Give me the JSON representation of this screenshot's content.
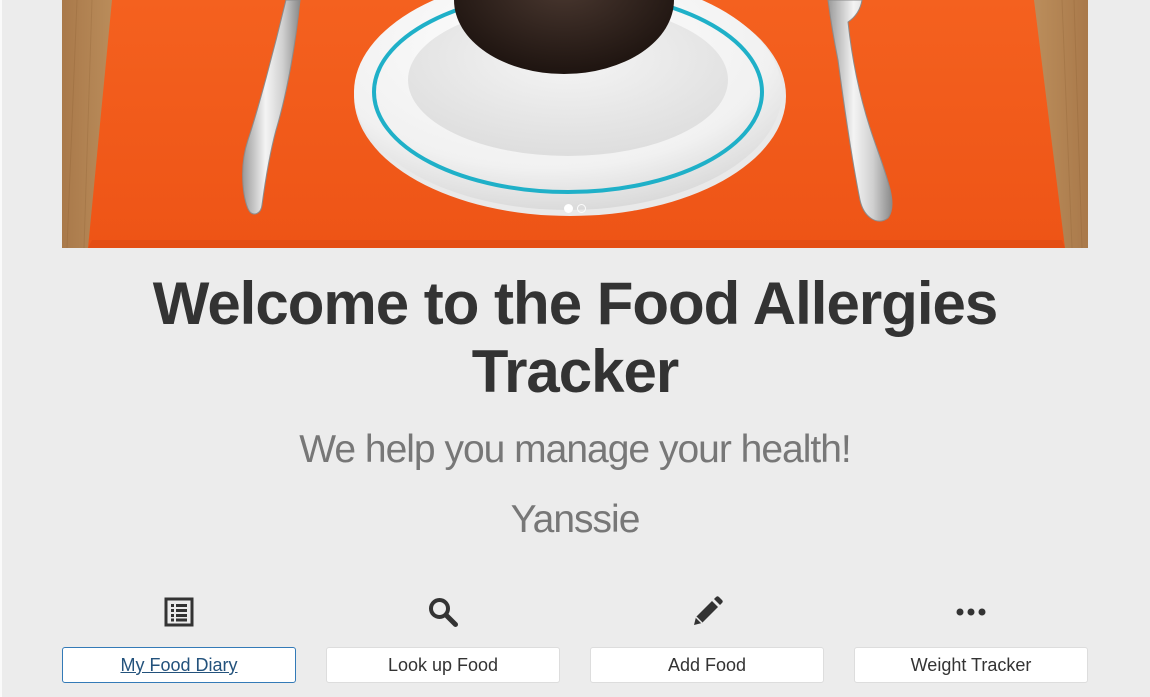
{
  "hero": {
    "slides": [
      "slide-1",
      "slide-2"
    ],
    "active_slide": 1,
    "colors": {
      "placemat": "#f25c1c",
      "table": "#c79c63",
      "plate_rim": "#1fb0c8"
    }
  },
  "header": {
    "title": "Welcome to the Food Allergies Tracker",
    "subtitle": "We help you manage your health!",
    "username": "Yanssie"
  },
  "nav": {
    "items": [
      {
        "label": "My Food Diary",
        "icon": "list-icon",
        "active": true
      },
      {
        "label": "Look up Food",
        "icon": "search-icon",
        "active": false
      },
      {
        "label": "Add Food",
        "icon": "pencil-icon",
        "active": false
      },
      {
        "label": "Weight Tracker",
        "icon": "more-dots-icon",
        "active": false
      }
    ]
  },
  "colors": {
    "background": "#ececec",
    "heading": "#333333",
    "muted_text": "#777777",
    "active_border": "#337ab7",
    "active_text": "#23527c"
  }
}
